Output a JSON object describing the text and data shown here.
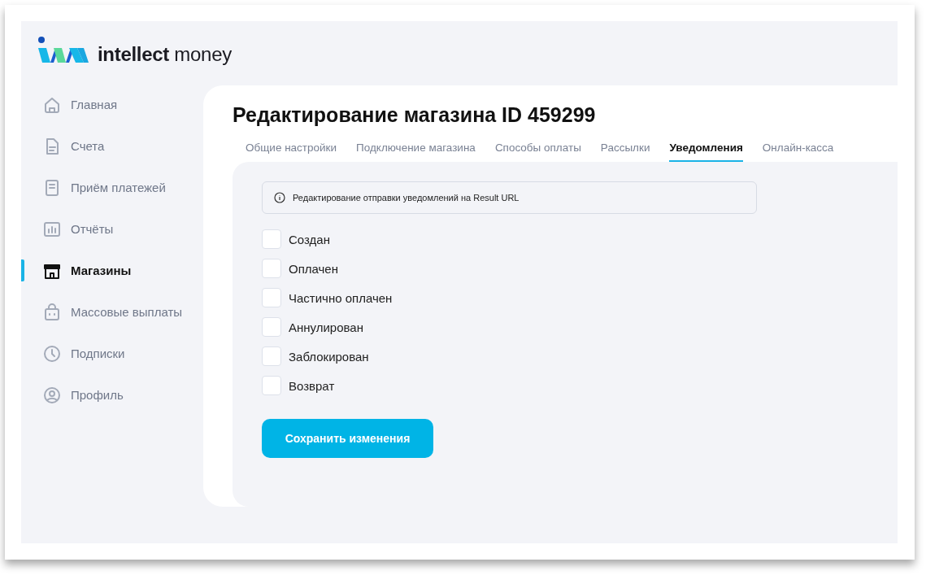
{
  "logo": {
    "word_bold": "intellect",
    "word_regular": "money"
  },
  "sidebar": {
    "items": [
      {
        "label": "Главная",
        "selected": false
      },
      {
        "label": "Счета",
        "selected": false
      },
      {
        "label": "Приём платежей",
        "selected": false
      },
      {
        "label": "Отчёты",
        "selected": false
      },
      {
        "label": "Магазины",
        "selected": true
      },
      {
        "label": "Массовые выплаты",
        "selected": false
      },
      {
        "label": "Подписки",
        "selected": false
      },
      {
        "label": "Профиль",
        "selected": false
      }
    ]
  },
  "page_title": "Редактирование магазина ID 459299",
  "tabs": [
    {
      "label": "Общие настройки",
      "selected": false
    },
    {
      "label": "Подключение магазина",
      "selected": false
    },
    {
      "label": "Способы оплаты",
      "selected": false
    },
    {
      "label": "Рассылки",
      "selected": false
    },
    {
      "label": "Уведомления",
      "selected": true
    },
    {
      "label": "Онлайн-касса",
      "selected": false
    }
  ],
  "info": "Редактирование отправки уведомлений на Result URL",
  "statuses": [
    {
      "label": "Создан",
      "checked": false
    },
    {
      "label": "Оплачен",
      "checked": false
    },
    {
      "label": "Частично оплачен",
      "checked": false
    },
    {
      "label": "Аннулирован",
      "checked": false
    },
    {
      "label": "Заблокирован",
      "checked": false
    },
    {
      "label": "Возврат",
      "checked": false
    }
  ],
  "save_button": "Сохранить изменения"
}
